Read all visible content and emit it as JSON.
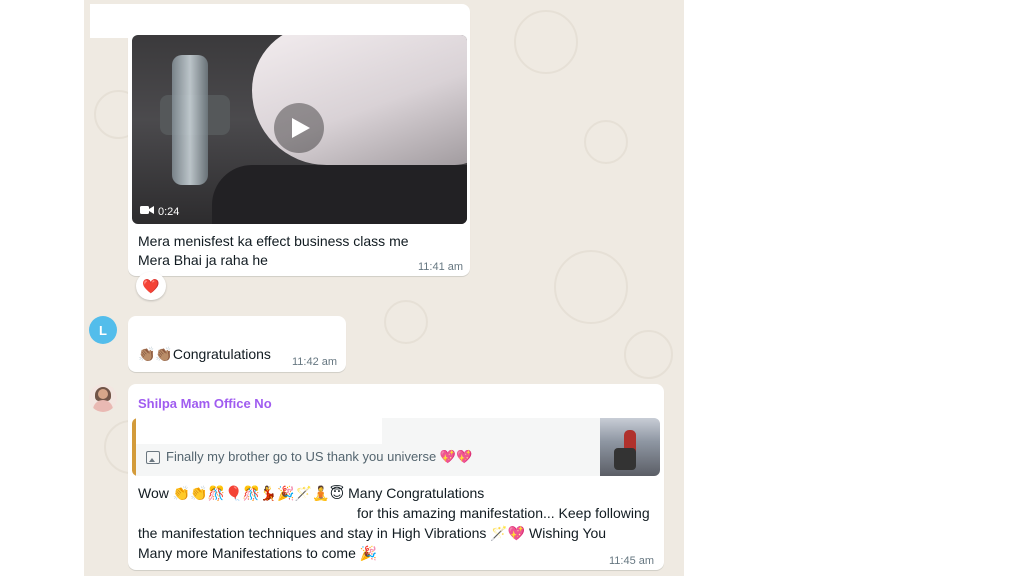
{
  "msg_video": {
    "duration": "0:24",
    "caption_line1": "Mera menisfest ka effect business class me",
    "caption_line2": "Mera Bhai ja raha he",
    "time": "11:41 am",
    "reaction": "❤️"
  },
  "msg_l": {
    "avatar_letter": "L",
    "text": "👏🏽👏🏽Congratulations",
    "time": "11:42 am"
  },
  "msg_shilpa": {
    "sender": "Shilpa Mam Office No",
    "quoted_text": "Finally my brother go to US thank you universe 💖💖",
    "line1": "Wow   👏👏🎊🎈🎊💃🎉🪄🧘😇 Many Congratulations",
    "line2": "for this amazing manifestation...  Keep following",
    "line3": "the manifestation techniques and stay in High Vibrations 🪄💖 Wishing You",
    "line4": "Many more Manifestations to come 🎉",
    "time": "11:45 am"
  },
  "icons": {
    "play": "play-icon",
    "video": "video-camera-icon",
    "image": "image-icon",
    "heart": "heart-icon"
  },
  "colors": {
    "chat_bg": "#efeae2",
    "bubble": "#ffffff",
    "sender_name": "#a05cf0",
    "quote_bar": "#d39b3a",
    "avatar_l": "#53bdeb"
  }
}
